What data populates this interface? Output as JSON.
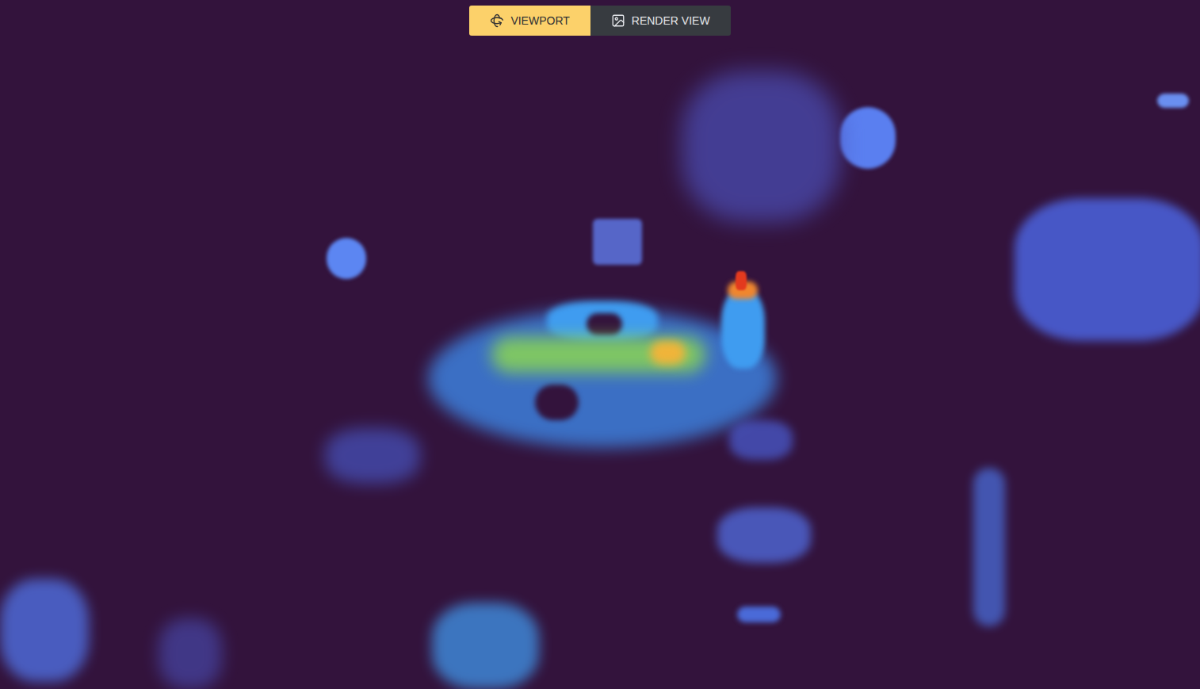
{
  "tabs": [
    {
      "label": "VIEWPORT",
      "selected": true
    },
    {
      "label": "RENDER VIEW",
      "selected": false
    }
  ],
  "viewport": {
    "kind": "depth-render"
  }
}
